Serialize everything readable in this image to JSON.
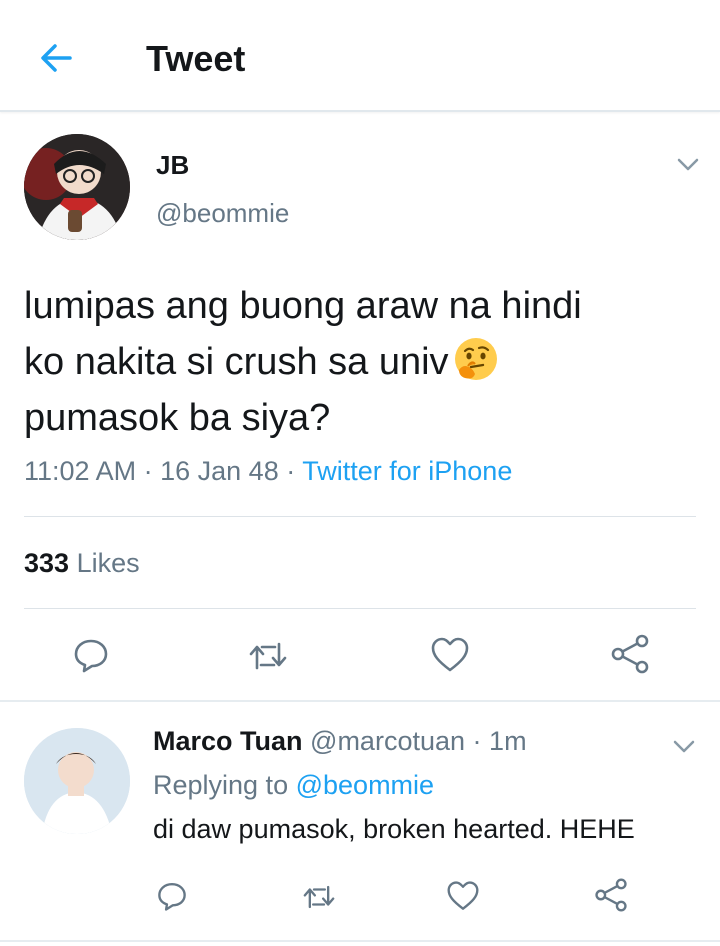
{
  "header": {
    "title": "Tweet",
    "back_icon": "arrow-left-icon"
  },
  "colors": {
    "accent": "#1da1f2",
    "text": "#14171a",
    "secondary_text": "#657786",
    "divider": "#e1e8ed"
  },
  "tweet": {
    "name": "JB",
    "handle": "@beommie",
    "text_lines": [
      "lumipas ang buong araw na hindi",
      "ko nakita si crush sa univ",
      "pumasok ba siya?"
    ],
    "emoji": "thinking-face-emoji",
    "time": "11:02 AM",
    "date": "16 Jan 48",
    "separator": "·",
    "source": "Twitter for iPhone",
    "likes_count": "333",
    "likes_label": "Likes"
  },
  "actions": [
    "reply-icon",
    "retweet-icon",
    "like-icon",
    "share-icon"
  ],
  "reply": {
    "name": "Marco Tuan",
    "handle": "@marcotuan",
    "separator": "·",
    "time": "1m",
    "replying_prefix": "Replying to",
    "replying_to": "@beommie",
    "text": "di daw pumasok, broken hearted. HEHE"
  }
}
